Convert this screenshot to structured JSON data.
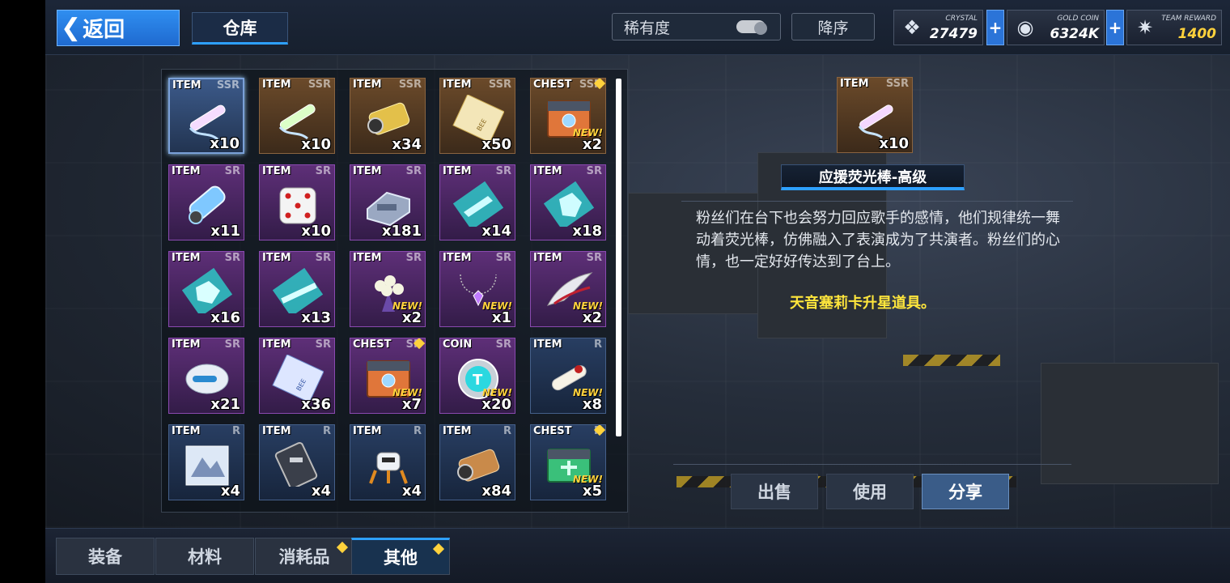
{
  "topbar": {
    "back_label": "返回",
    "warehouse_tab": "仓库",
    "rarity_sort": "稀有度",
    "order_sort": "降序",
    "plus": "+"
  },
  "currencies": [
    {
      "name": "CRYSTAL",
      "value": "27479",
      "value_color": "#ffffff",
      "icon": "crystal-icon",
      "glyph": "❖"
    },
    {
      "name": "GOLD COIN",
      "value": "6324K",
      "value_color": "#ffffff",
      "icon": "gold-coin-icon",
      "glyph": "◉"
    },
    {
      "name": "TEAM REWARD",
      "value": "1400",
      "value_color": "#ffd23c",
      "icon": "team-reward-icon",
      "glyph": "✷"
    }
  ],
  "items": [
    {
      "type": "ITEM",
      "rarity": "SSR",
      "count": "x10",
      "new": false,
      "dot": false,
      "art": "pink-glowstick",
      "tier": "ssr blue",
      "selected": true
    },
    {
      "type": "ITEM",
      "rarity": "SSR",
      "count": "x10",
      "new": false,
      "dot": false,
      "art": "green-glowstick",
      "tier": "ssr"
    },
    {
      "type": "ITEM",
      "rarity": "SSR",
      "count": "x34",
      "new": false,
      "dot": false,
      "art": "gold-capsule",
      "tier": "ssr"
    },
    {
      "type": "ITEM",
      "rarity": "SSR",
      "count": "x50",
      "new": false,
      "dot": false,
      "art": "gold-ticket",
      "tier": "ssr"
    },
    {
      "type": "CHEST",
      "rarity": "SSR",
      "count": "x2",
      "new": true,
      "dot": true,
      "art": "orange-chest",
      "tier": "ssr"
    },
    {
      "type": "ITEM",
      "rarity": "SR",
      "count": "x11",
      "new": false,
      "dot": false,
      "art": "blue-vial",
      "tier": "sr"
    },
    {
      "type": "ITEM",
      "rarity": "SR",
      "count": "x10",
      "new": false,
      "dot": false,
      "art": "dice",
      "tier": "sr"
    },
    {
      "type": "ITEM",
      "rarity": "SR",
      "count": "x181",
      "new": false,
      "dot": false,
      "art": "mech-part",
      "tier": "sr"
    },
    {
      "type": "ITEM",
      "rarity": "SR",
      "count": "x14",
      "new": false,
      "dot": false,
      "art": "blueprint-weapon",
      "tier": "sr"
    },
    {
      "type": "ITEM",
      "rarity": "SR",
      "count": "x18",
      "new": false,
      "dot": false,
      "art": "blueprint-armor",
      "tier": "sr"
    },
    {
      "type": "ITEM",
      "rarity": "SR",
      "count": "x16",
      "new": false,
      "dot": false,
      "art": "blueprint-core",
      "tier": "sr"
    },
    {
      "type": "ITEM",
      "rarity": "SR",
      "count": "x13",
      "new": false,
      "dot": false,
      "art": "blueprint-rifle",
      "tier": "sr"
    },
    {
      "type": "ITEM",
      "rarity": "SR",
      "count": "x2",
      "new": true,
      "dot": false,
      "art": "bouquet",
      "tier": "sr"
    },
    {
      "type": "ITEM",
      "rarity": "SR",
      "count": "x1",
      "new": true,
      "dot": false,
      "art": "necklace",
      "tier": "sr"
    },
    {
      "type": "ITEM",
      "rarity": "SR",
      "count": "x2",
      "new": true,
      "dot": false,
      "art": "silver-wing",
      "tier": "sr"
    },
    {
      "type": "ITEM",
      "rarity": "SR",
      "count": "x21",
      "new": false,
      "dot": false,
      "art": "helmet",
      "tier": "sr"
    },
    {
      "type": "ITEM",
      "rarity": "SR",
      "count": "x36",
      "new": false,
      "dot": false,
      "art": "blue-ticket",
      "tier": "sr"
    },
    {
      "type": "CHEST",
      "rarity": "SR",
      "count": "x7",
      "new": true,
      "dot": true,
      "art": "orange-chest",
      "tier": "sr"
    },
    {
      "type": "COIN",
      "rarity": "SR",
      "count": "x20",
      "new": true,
      "dot": false,
      "art": "coin",
      "tier": "sr"
    },
    {
      "type": "ITEM",
      "rarity": "R",
      "count": "x8",
      "new": true,
      "dot": false,
      "art": "scroll",
      "tier": "r"
    },
    {
      "type": "ITEM",
      "rarity": "R",
      "count": "x4",
      "new": false,
      "dot": false,
      "art": "photo-card",
      "tier": "r"
    },
    {
      "type": "ITEM",
      "rarity": "R",
      "count": "x4",
      "new": false,
      "dot": false,
      "art": "dark-module",
      "tier": "r"
    },
    {
      "type": "ITEM",
      "rarity": "R",
      "count": "x4",
      "new": false,
      "dot": false,
      "art": "robot",
      "tier": "r"
    },
    {
      "type": "ITEM",
      "rarity": "R",
      "count": "x84",
      "new": false,
      "dot": false,
      "art": "copper-capsule",
      "tier": "r"
    },
    {
      "type": "CHEST",
      "rarity": "R",
      "count": "x5",
      "new": true,
      "dot": true,
      "art": "green-chest",
      "tier": "r"
    }
  ],
  "new_label": "NEW!",
  "detail": {
    "type": "ITEM",
    "rarity": "SSR",
    "count": "x10",
    "name": "应援荧光棒-高级",
    "description": "粉丝们在台下也会努力回应歌手的感情，他们规律统一舞动着荧光棒，仿佛融入了表演成为了共演者。粉丝们的心情，也一定好好传达到了台上。",
    "note": "天音塞莉卡升星道具。"
  },
  "actions": {
    "sell": "出售",
    "use": "使用",
    "share": "分享"
  },
  "bottom_tabs": [
    {
      "label": "装备",
      "dot": false,
      "active": false
    },
    {
      "label": "材料",
      "dot": false,
      "active": false
    },
    {
      "label": "消耗品",
      "dot": true,
      "active": false
    },
    {
      "label": "其他",
      "dot": true,
      "active": true
    }
  ],
  "colors": {
    "accent": "#2ea0ff",
    "new_badge": "#ffd23c",
    "note": "#ffe63c"
  }
}
